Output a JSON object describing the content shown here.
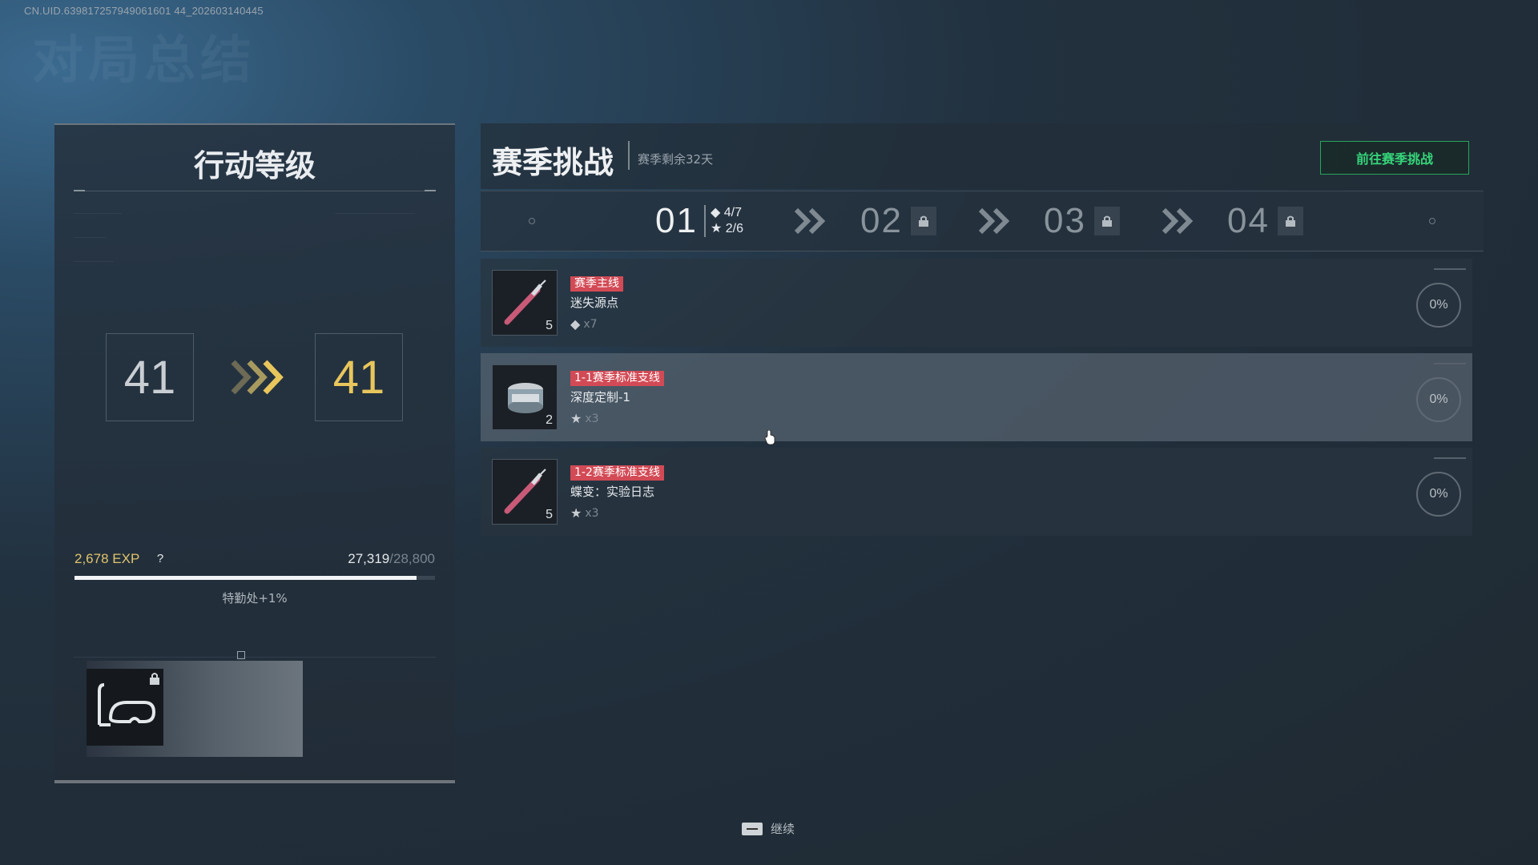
{
  "uid": "CN.UID.639817257949061601 44_202603140445",
  "ghost_title": "对局总结",
  "level": {
    "title": "行动等级",
    "from": "41",
    "to": "41",
    "exp_gain": "2,678 EXP",
    "help": "?",
    "exp_current": "27,319",
    "exp_max": "/28,800",
    "progress": 0.9486,
    "bonus": "特勤处+1%",
    "reward_icon": "snorkel-mask-icon"
  },
  "season": {
    "title": "赛季挑战",
    "remaining": "赛季剩余32天",
    "goto_button": "前往赛季挑战",
    "accent": "#36d57a",
    "stages": [
      {
        "num": "01",
        "diamonds": "4/7",
        "stars": "2/6",
        "locked": false
      },
      {
        "num": "02",
        "locked": true
      },
      {
        "num": "03",
        "locked": true
      },
      {
        "num": "04",
        "locked": true
      }
    ],
    "tasks": [
      {
        "tag": "赛季主线",
        "name": "迷失源点",
        "reward_glyph": "◆",
        "reward_count": "x7",
        "count": "5",
        "percent": "0%",
        "icon": "syringe-icon"
      },
      {
        "tag": "1-1赛季标准支线",
        "name": "深度定制-1",
        "reward_glyph": "★",
        "reward_count": "x3",
        "count": "2",
        "percent": "0%",
        "icon": "tin-can-icon"
      },
      {
        "tag": "1-2赛季标准支线",
        "name": "蝶变：实验日志",
        "reward_glyph": "★",
        "reward_count": "x3",
        "count": "5",
        "percent": "0%",
        "icon": "syringe-icon"
      }
    ]
  },
  "continue_label": "继续"
}
